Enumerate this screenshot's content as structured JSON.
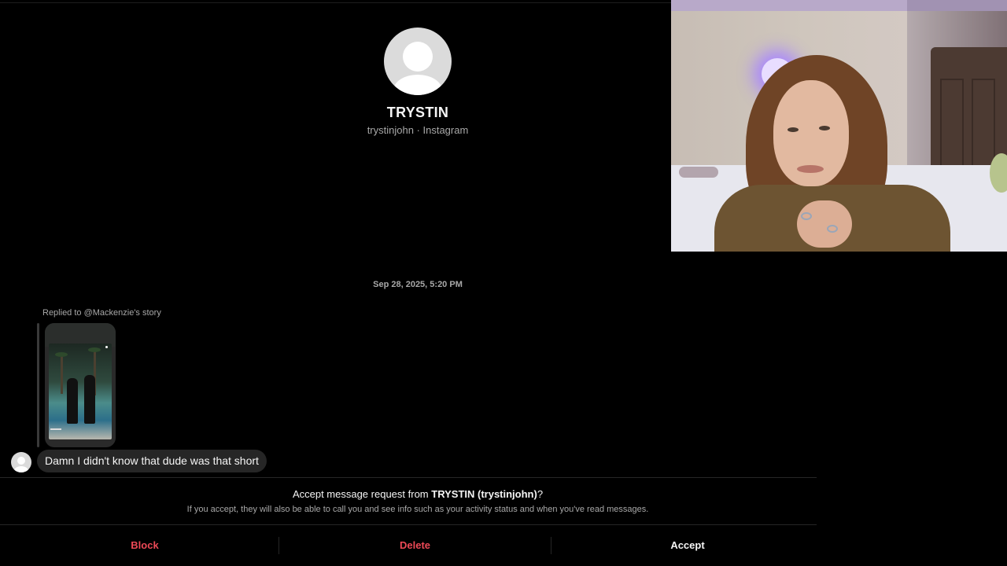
{
  "profile": {
    "name": "TRYSTIN",
    "subtitle": "trystinjohn · Instagram",
    "avatar_icon": "default-avatar-icon"
  },
  "conversation": {
    "timestamp": "Sep 28, 2025, 5:20 PM",
    "reply_context": "Replied to @Mackenzie's story",
    "messages": [
      {
        "text": "Damn I didn't know that dude was that short"
      }
    ]
  },
  "request": {
    "title_prefix": "Accept message request from ",
    "title_name": "TRYSTIN (trystinjohn)",
    "title_suffix": "?",
    "description": "If you accept, they will also be able to call you and see info such as your activity status and when you've read messages."
  },
  "actions": {
    "block_label": "Block",
    "delete_label": "Delete",
    "accept_label": "Accept"
  },
  "colors": {
    "background": "#000000",
    "danger": "#ED4956",
    "bubble": "#262626",
    "secondary_text": "#A8A8A8"
  }
}
